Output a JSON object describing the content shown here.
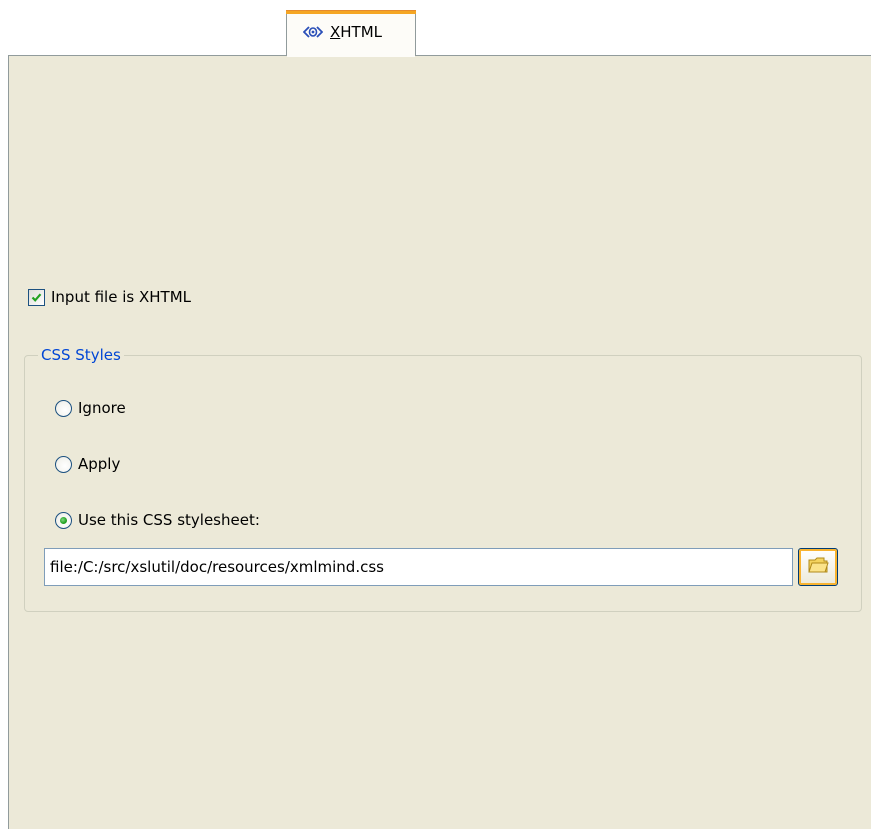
{
  "tab": {
    "icon": "xhtml-tab-icon",
    "label_mnemonic": "X",
    "label_rest": "HTML"
  },
  "input_is_xhtml": {
    "label": "Input file is XHTML",
    "checked": true
  },
  "css_styles": {
    "title": "CSS Styles",
    "options": [
      {
        "label": "Ignore",
        "selected": false
      },
      {
        "label": "Apply",
        "selected": false
      },
      {
        "label": "Use this CSS stylesheet:",
        "selected": true
      }
    ],
    "stylesheet_path": "file:/C:/src/xslutil/doc/resources/xmlmind.css",
    "browse_icon": "folder-icon"
  },
  "colors": {
    "panel_bg": "#ece9d8",
    "group_title": "#0046d5",
    "tab_accent": "#f5a623",
    "check_mark": "#21a121"
  }
}
